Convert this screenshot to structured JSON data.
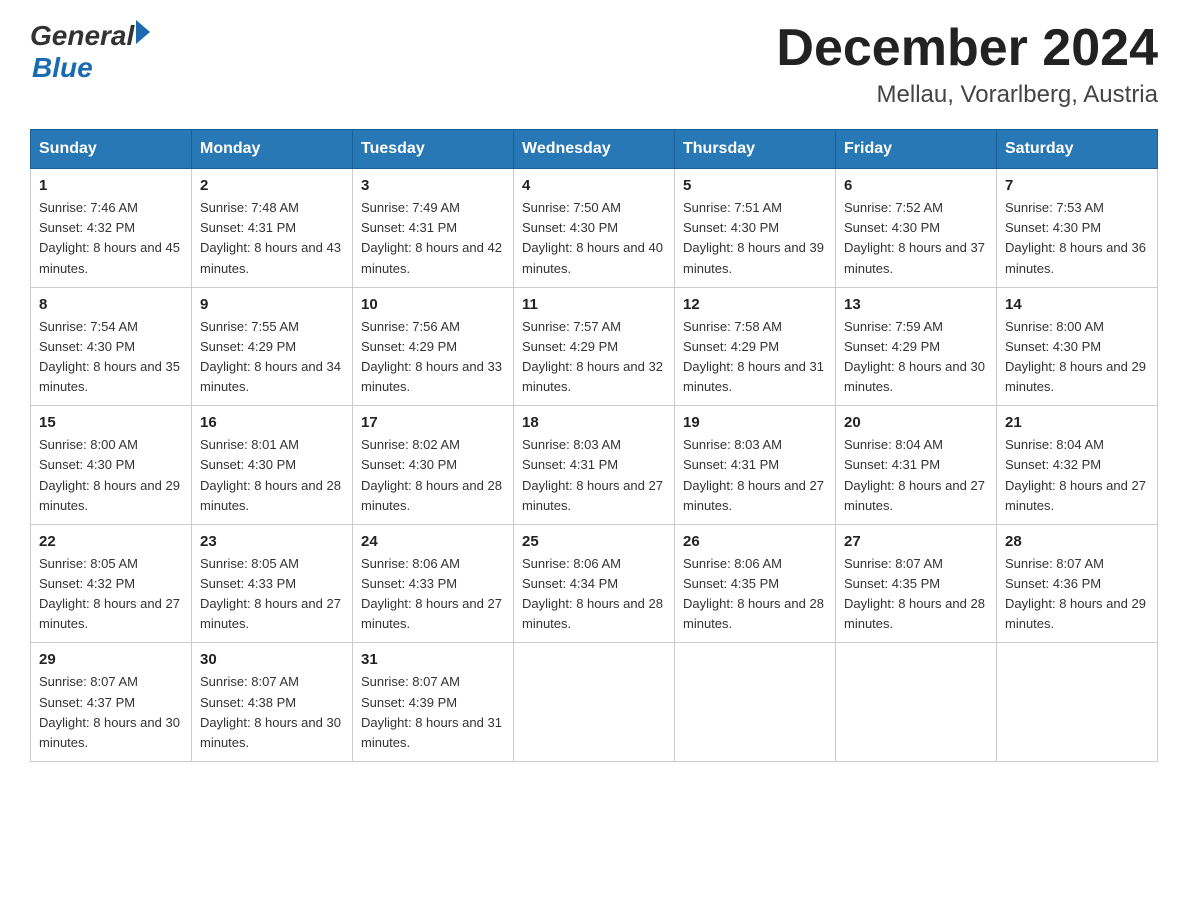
{
  "header": {
    "logo": {
      "general": "General",
      "blue": "Blue",
      "arrow": true
    },
    "title": "December 2024",
    "location": "Mellau, Vorarlberg, Austria"
  },
  "calendar": {
    "weekdays": [
      "Sunday",
      "Monday",
      "Tuesday",
      "Wednesday",
      "Thursday",
      "Friday",
      "Saturday"
    ],
    "weeks": [
      [
        {
          "day": "1",
          "sunrise": "7:46 AM",
          "sunset": "4:32 PM",
          "daylight": "8 hours and 45 minutes."
        },
        {
          "day": "2",
          "sunrise": "7:48 AM",
          "sunset": "4:31 PM",
          "daylight": "8 hours and 43 minutes."
        },
        {
          "day": "3",
          "sunrise": "7:49 AM",
          "sunset": "4:31 PM",
          "daylight": "8 hours and 42 minutes."
        },
        {
          "day": "4",
          "sunrise": "7:50 AM",
          "sunset": "4:30 PM",
          "daylight": "8 hours and 40 minutes."
        },
        {
          "day": "5",
          "sunrise": "7:51 AM",
          "sunset": "4:30 PM",
          "daylight": "8 hours and 39 minutes."
        },
        {
          "day": "6",
          "sunrise": "7:52 AM",
          "sunset": "4:30 PM",
          "daylight": "8 hours and 37 minutes."
        },
        {
          "day": "7",
          "sunrise": "7:53 AM",
          "sunset": "4:30 PM",
          "daylight": "8 hours and 36 minutes."
        }
      ],
      [
        {
          "day": "8",
          "sunrise": "7:54 AM",
          "sunset": "4:30 PM",
          "daylight": "8 hours and 35 minutes."
        },
        {
          "day": "9",
          "sunrise": "7:55 AM",
          "sunset": "4:29 PM",
          "daylight": "8 hours and 34 minutes."
        },
        {
          "day": "10",
          "sunrise": "7:56 AM",
          "sunset": "4:29 PM",
          "daylight": "8 hours and 33 minutes."
        },
        {
          "day": "11",
          "sunrise": "7:57 AM",
          "sunset": "4:29 PM",
          "daylight": "8 hours and 32 minutes."
        },
        {
          "day": "12",
          "sunrise": "7:58 AM",
          "sunset": "4:29 PM",
          "daylight": "8 hours and 31 minutes."
        },
        {
          "day": "13",
          "sunrise": "7:59 AM",
          "sunset": "4:29 PM",
          "daylight": "8 hours and 30 minutes."
        },
        {
          "day": "14",
          "sunrise": "8:00 AM",
          "sunset": "4:30 PM",
          "daylight": "8 hours and 29 minutes."
        }
      ],
      [
        {
          "day": "15",
          "sunrise": "8:00 AM",
          "sunset": "4:30 PM",
          "daylight": "8 hours and 29 minutes."
        },
        {
          "day": "16",
          "sunrise": "8:01 AM",
          "sunset": "4:30 PM",
          "daylight": "8 hours and 28 minutes."
        },
        {
          "day": "17",
          "sunrise": "8:02 AM",
          "sunset": "4:30 PM",
          "daylight": "8 hours and 28 minutes."
        },
        {
          "day": "18",
          "sunrise": "8:03 AM",
          "sunset": "4:31 PM",
          "daylight": "8 hours and 27 minutes."
        },
        {
          "day": "19",
          "sunrise": "8:03 AM",
          "sunset": "4:31 PM",
          "daylight": "8 hours and 27 minutes."
        },
        {
          "day": "20",
          "sunrise": "8:04 AM",
          "sunset": "4:31 PM",
          "daylight": "8 hours and 27 minutes."
        },
        {
          "day": "21",
          "sunrise": "8:04 AM",
          "sunset": "4:32 PM",
          "daylight": "8 hours and 27 minutes."
        }
      ],
      [
        {
          "day": "22",
          "sunrise": "8:05 AM",
          "sunset": "4:32 PM",
          "daylight": "8 hours and 27 minutes."
        },
        {
          "day": "23",
          "sunrise": "8:05 AM",
          "sunset": "4:33 PM",
          "daylight": "8 hours and 27 minutes."
        },
        {
          "day": "24",
          "sunrise": "8:06 AM",
          "sunset": "4:33 PM",
          "daylight": "8 hours and 27 minutes."
        },
        {
          "day": "25",
          "sunrise": "8:06 AM",
          "sunset": "4:34 PM",
          "daylight": "8 hours and 28 minutes."
        },
        {
          "day": "26",
          "sunrise": "8:06 AM",
          "sunset": "4:35 PM",
          "daylight": "8 hours and 28 minutes."
        },
        {
          "day": "27",
          "sunrise": "8:07 AM",
          "sunset": "4:35 PM",
          "daylight": "8 hours and 28 minutes."
        },
        {
          "day": "28",
          "sunrise": "8:07 AM",
          "sunset": "4:36 PM",
          "daylight": "8 hours and 29 minutes."
        }
      ],
      [
        {
          "day": "29",
          "sunrise": "8:07 AM",
          "sunset": "4:37 PM",
          "daylight": "8 hours and 30 minutes."
        },
        {
          "day": "30",
          "sunrise": "8:07 AM",
          "sunset": "4:38 PM",
          "daylight": "8 hours and 30 minutes."
        },
        {
          "day": "31",
          "sunrise": "8:07 AM",
          "sunset": "4:39 PM",
          "daylight": "8 hours and 31 minutes."
        },
        null,
        null,
        null,
        null
      ]
    ]
  }
}
